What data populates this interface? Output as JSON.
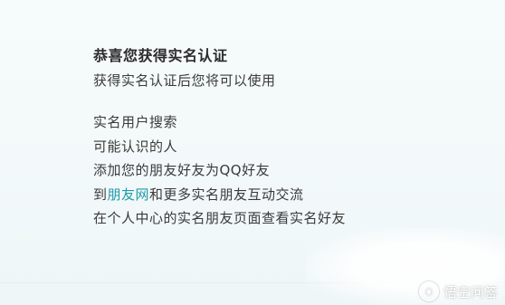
{
  "title": "恭喜您获得实名认证",
  "subtitle": "获得实名认证后您将可以使用",
  "features": [
    "实名用户搜索",
    "可能认识的人",
    "添加您的朋友好友为QQ好友",
    "和更多实名朋友互动交流",
    "在个人中心的实名朋友页面查看实名好友"
  ],
  "feature_4_prefix": "到",
  "feature_4_link": "朋友网",
  "watermark": {
    "text": "悟空问答",
    "icon": "wukong-logo-icon"
  }
}
